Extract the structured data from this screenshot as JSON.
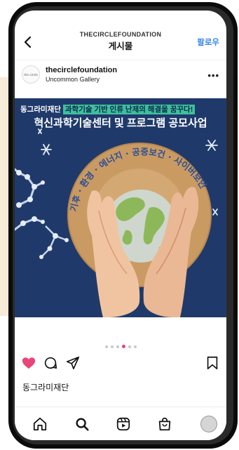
{
  "topbar": {
    "back_icon": "chevron-left-icon",
    "username": "THECIRCLEFOUNDATION",
    "title": "게시물",
    "follow_label": "팔로우"
  },
  "post": {
    "account_name": "thecirclefoundation",
    "account_subtitle": "Uncommon Gallery",
    "avatar_text": "the circle",
    "more_icon": "more-horizontal-icon",
    "image": {
      "banner_prefix": "동그라미재단",
      "banner_highlight": "과학기술 기반 인류 난제의 해결을 꿈꾸다!",
      "banner_title": "혁신과학기술센터 및 프로그램 공모사업",
      "arc_text": "기후 · 환경 · 에너지 · 공중보건 · 사이버보안"
    },
    "carousel": {
      "count": 6,
      "active_index": 3
    },
    "liked": true,
    "caption": "동그라미재단"
  },
  "colors": {
    "accent_blue": "#3a86e8",
    "like_pink": "#e8467a",
    "image_navy": "#1f3a6a",
    "highlight_green": "#3fbf9e",
    "arc_cork": "#c99a62"
  },
  "tabbar": {
    "items": [
      "home-icon",
      "search-icon",
      "reels-icon",
      "shop-icon",
      "profile-avatar"
    ]
  }
}
